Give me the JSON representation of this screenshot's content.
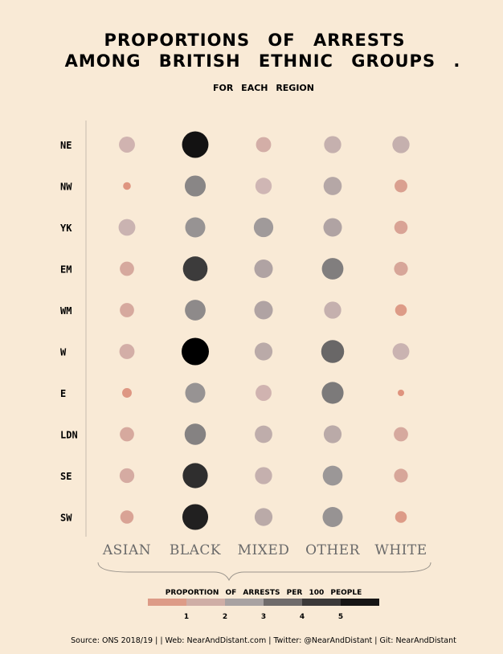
{
  "chart_data": {
    "type": "scatter",
    "title_lines": [
      "PROPORTIONS OF ARRESTS",
      "AMONG BRITISH ETHNIC GROUPS ."
    ],
    "subtitle": "FOR EACH REGION",
    "regions": [
      "NE",
      "NW",
      "YK",
      "EM",
      "WM",
      "W",
      "E",
      "LDN",
      "SE",
      "SW"
    ],
    "groups": [
      "ASIAN",
      "BLACK",
      "MIXED",
      "OTHER",
      "WHITE"
    ],
    "values": [
      [
        1.9,
        5.6,
        1.7,
        2.2,
        2.2
      ],
      [
        0.5,
        3.4,
        2.0,
        2.5,
        1.2
      ],
      [
        2.1,
        3.1,
        2.9,
        2.6,
        1.3
      ],
      [
        1.5,
        4.8,
        2.6,
        3.6,
        1.4
      ],
      [
        1.5,
        3.3,
        2.6,
        2.2,
        1.0
      ],
      [
        1.7,
        6.0,
        2.4,
        4.1,
        2.1
      ],
      [
        0.7,
        3.1,
        1.9,
        3.7,
        0.4
      ],
      [
        1.5,
        3.5,
        2.3,
        2.4,
        1.5
      ],
      [
        1.6,
        5.0,
        2.2,
        3.0,
        1.4
      ],
      [
        1.3,
        5.3,
        2.4,
        3.1,
        1.0
      ]
    ],
    "legend": {
      "title": "PROPORTION OF ARRESTS PER 100 PEOPLE",
      "ticks": [
        "1",
        "2",
        "3",
        "4",
        "5"
      ],
      "colors": [
        "#dd9b87",
        "#cfaea6",
        "#a8a2a2",
        "#6f6b6b",
        "#3b3939",
        "#161515"
      ]
    },
    "color_scale": {
      "stops": [
        0,
        1,
        2,
        3,
        4,
        5,
        6
      ],
      "colors": [
        "#e08e78",
        "#dd9b87",
        "#cfb6b4",
        "#9b9797",
        "#6f6d6d",
        "#2f2e2e",
        "#000000"
      ]
    },
    "size_range": [
      0.3,
      6.0
    ]
  },
  "source_text": "Source: ONS 2018/19 | | Web: NearAndDistant.com | Twitter: @NearAndDistant | Git: NearAndDistant"
}
